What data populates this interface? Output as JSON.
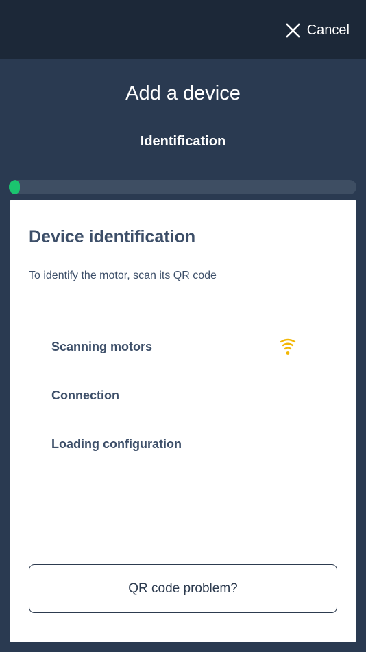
{
  "topbar": {
    "cancel_label": "Cancel",
    "cancel_icon": "close-icon"
  },
  "header": {
    "title": "Add a device",
    "subtitle": "Identification",
    "progress": 0.02,
    "progress_color": "#1bc46f"
  },
  "card": {
    "title": "Device identification",
    "description": "To identify the motor, scan its QR code",
    "steps": [
      {
        "label": "Scanning motors",
        "status_icon": "wifi-scanning-icon",
        "status_color": "#f2b705"
      },
      {
        "label": "Connection"
      },
      {
        "label": "Loading configuration"
      }
    ],
    "qr_problem_label": "QR code problem?"
  },
  "colors": {
    "topbar_bg": "#1c2838",
    "header_bg": "#2a3a51",
    "text_dark": "#3d4f69"
  }
}
